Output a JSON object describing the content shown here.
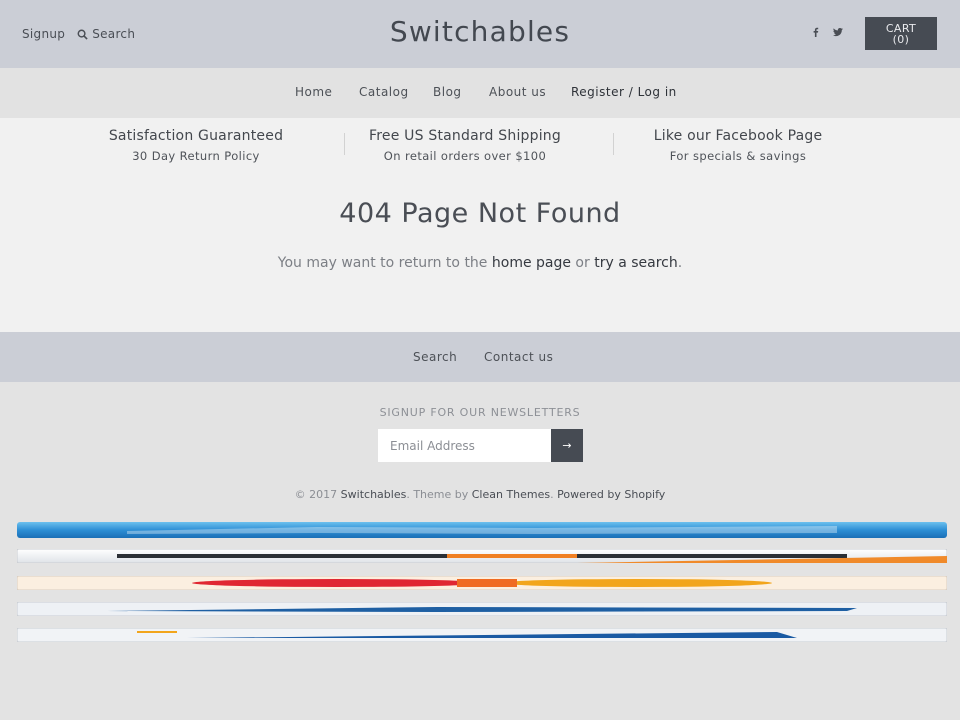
{
  "header": {
    "signup": "Signup",
    "search": "Search",
    "brand": "Switchables",
    "cart_label": "CART",
    "cart_count": "(0)"
  },
  "nav": {
    "items": [
      "Home",
      "Catalog",
      "Blog",
      "About us"
    ],
    "account": "Register / Log in"
  },
  "features": [
    {
      "title": "Satisfaction Guaranteed",
      "subtitle": "30 Day Return Policy"
    },
    {
      "title": "Free US Standard Shipping",
      "subtitle": "On retail orders over $100"
    },
    {
      "title": "Like our Facebook Page",
      "subtitle": "For specials & savings"
    }
  ],
  "error": {
    "title": "404 Page Not Found",
    "text_before": "You may want to return to the ",
    "home_link": "home page",
    "text_mid": " or ",
    "search_link": "try a search",
    "text_after": "."
  },
  "footer_nav": [
    "Search",
    "Contact us"
  ],
  "newsletter": {
    "label": "SIGNUP FOR OUR NEWSLETTERS",
    "placeholder": "Email Address",
    "button": "→"
  },
  "credits": {
    "prefix": "© 2017 ",
    "store": "Switchables",
    "theme_text": ". Theme by ",
    "theme": "Clean Themes",
    "sep": ". ",
    "powered": "Powered by Shopify"
  },
  "payments": [
    "american-express-card",
    "discover-card",
    "mastercard-card",
    "paypal-card",
    "visa-card"
  ],
  "colors": {
    "header_bg": "#cbced6",
    "button_bg": "#464b53"
  }
}
